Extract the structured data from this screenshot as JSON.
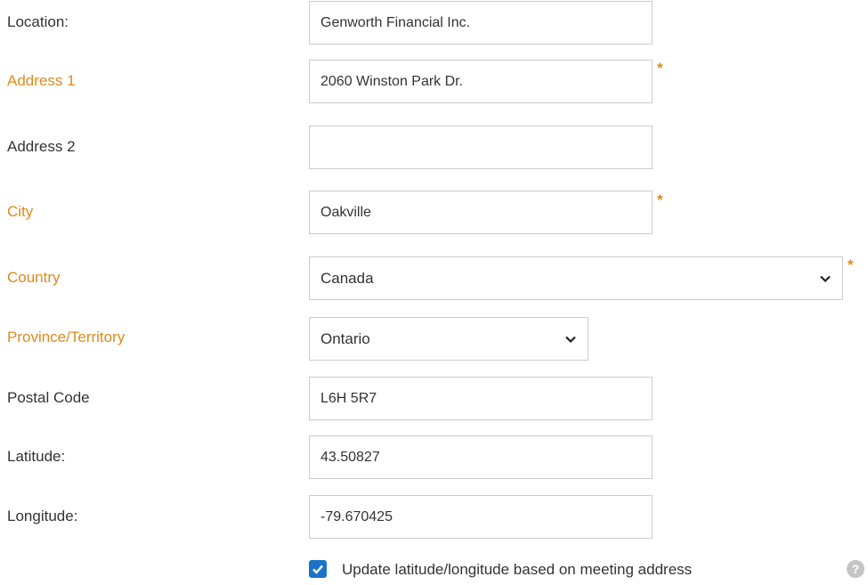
{
  "form": {
    "location": {
      "label": "Location:",
      "value": "Genworth Financial Inc."
    },
    "address1": {
      "label": "Address 1",
      "value": "2060 Winston Park Dr.",
      "required_mark": "*"
    },
    "address2": {
      "label": "Address 2",
      "value": ""
    },
    "city": {
      "label": "City",
      "value": "Oakville",
      "required_mark": "*"
    },
    "country": {
      "label": "Country",
      "value": "Canada",
      "required_mark": "*"
    },
    "province": {
      "label": "Province/Territory",
      "value": "Ontario"
    },
    "postal_code": {
      "label": "Postal Code",
      "value": "L6H 5R7"
    },
    "latitude": {
      "label": "Latitude:",
      "value": "43.50827"
    },
    "longitude": {
      "label": "Longitude:",
      "value": "-79.670425"
    },
    "update_latlong": {
      "label": "Update latitude/longitude based on meeting address",
      "checked": true,
      "help_glyph": "?"
    }
  },
  "colors": {
    "required": "#e08a1e",
    "checkbox": "#1a73c8",
    "help_icon": "#c4c4c4"
  }
}
